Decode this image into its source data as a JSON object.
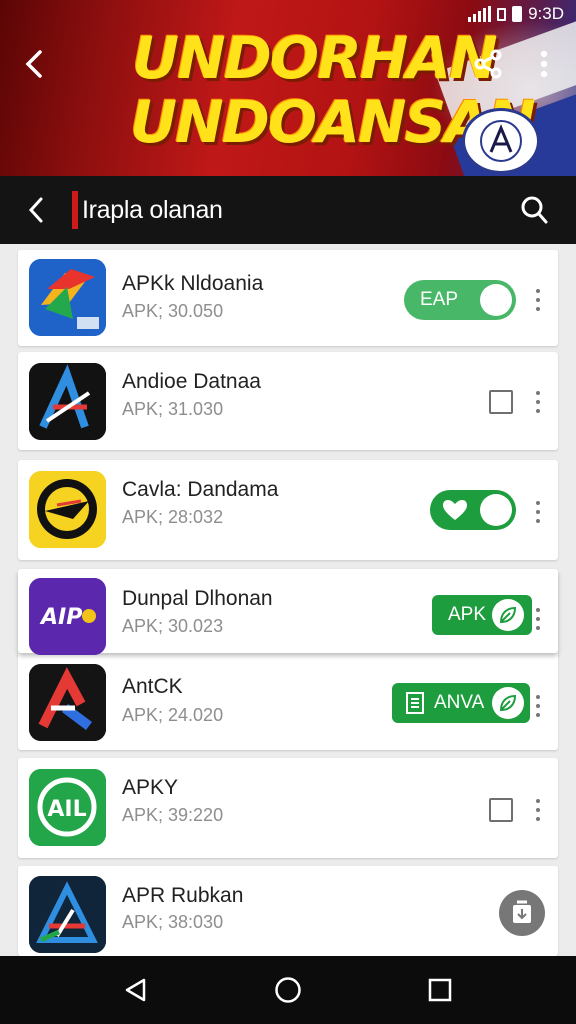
{
  "status_bar": {
    "time": "9:3D"
  },
  "header": {
    "title_line1": "UNDORHAN",
    "title_line2": "UNDOANSAN",
    "icons": {
      "back": "back-arrow-icon",
      "share": "share-icon",
      "more": "more-vert-icon"
    }
  },
  "toolbar": {
    "title": "Irapla olanan"
  },
  "apps": [
    {
      "name": "APKk Nldoania",
      "meta": "APK; 30.050",
      "action": "toggle",
      "action_label": "EAP",
      "action_color": "#48b868"
    },
    {
      "name": "Andioe Datnaa",
      "meta": "APK; 31.030",
      "action": "checkbox"
    },
    {
      "name": "Cavla: Dandama",
      "meta": "APK; 28:032",
      "action": "toggle",
      "action_label": "",
      "action_color": "#1e9d3f"
    },
    {
      "name": "Dunpal Dlhonan",
      "meta": "APK; 30.023",
      "action": "pill",
      "action_label": "APK"
    },
    {
      "name": "AntCK",
      "meta": "APK; 24.020",
      "action": "pill",
      "action_label": "ANVA"
    },
    {
      "name": "APKY",
      "meta": "APK; 39:220",
      "action": "checkbox",
      "icon_text": "AIL"
    },
    {
      "name": "APR Rubkan",
      "meta": "APK; 38:030",
      "action": "fab"
    }
  ],
  "icon_texts": {
    "app4": "AIP"
  },
  "nav": {
    "back": "nav-back-icon",
    "home": "nav-home-icon",
    "recents": "nav-recents-icon"
  }
}
